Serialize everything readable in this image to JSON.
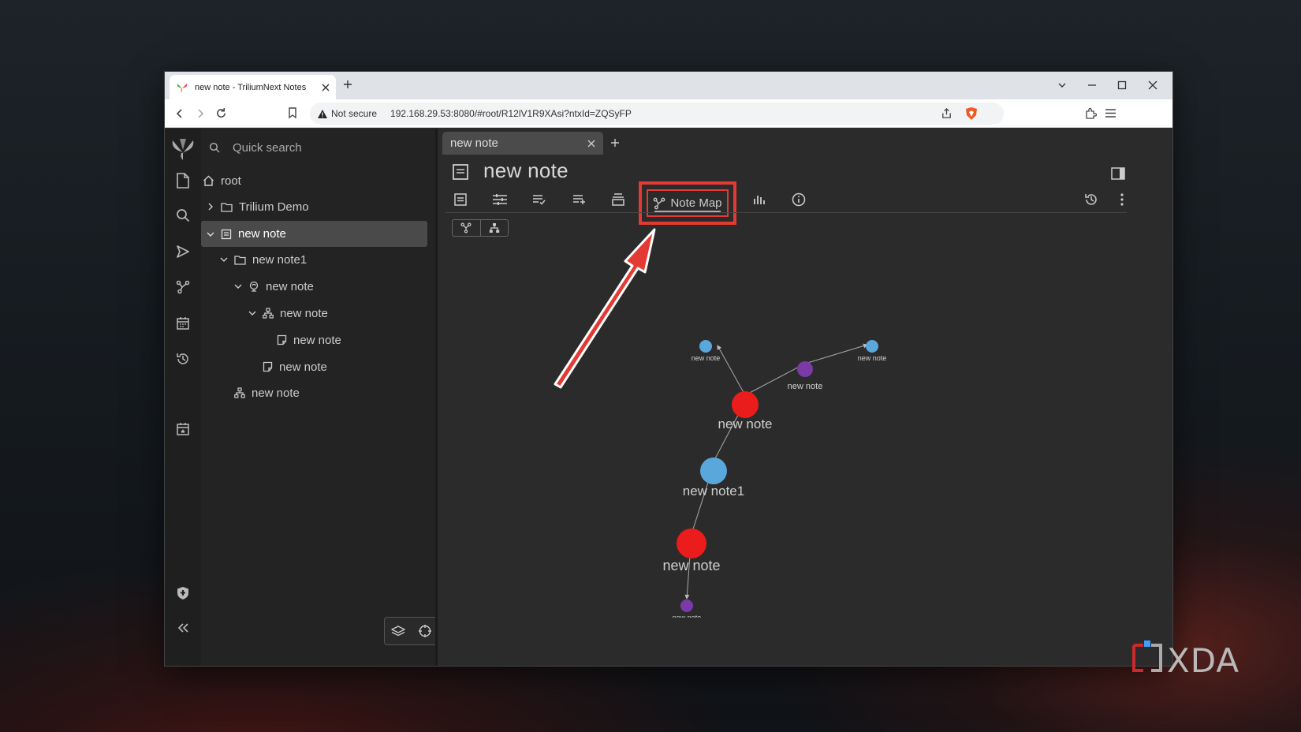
{
  "browser": {
    "tab_title": "new note - TriliumNext Notes",
    "security_label": "Not secure",
    "url": "192.168.29.53:8080/#root/R12lV1R9XAsi?ntxId=ZQSyFP"
  },
  "sidebar": {
    "quick_search_placeholder": "Quick search",
    "tree": {
      "root": "root",
      "items": [
        {
          "label": "Trilium Demo",
          "icon": "folder-icon",
          "expanded": false
        },
        {
          "label": "new note",
          "icon": "book-icon",
          "expanded": true,
          "selected": true
        },
        {
          "label": "new note1",
          "icon": "folder-icon",
          "expanded": true
        },
        {
          "label": "new note",
          "icon": "mind-map-icon",
          "expanded": true
        },
        {
          "label": "new note",
          "icon": "hierarchy-icon",
          "expanded": true
        },
        {
          "label": "new note",
          "icon": "note-icon"
        },
        {
          "label": "new note",
          "icon": "note-icon"
        },
        {
          "label": "new note",
          "icon": "hierarchy-icon"
        }
      ]
    }
  },
  "note_tab": {
    "label": "new note"
  },
  "note": {
    "title": "new note",
    "ribbon": {
      "active_tab": "Note Map"
    }
  },
  "note_map": {
    "node_colors": {
      "red": "#ea1c1c",
      "blue": "#5aa7dc",
      "purple": "#7b3aa8"
    },
    "nodes": [
      {
        "label": "new note",
        "color": "red",
        "size": "large"
      },
      {
        "label": "new note1",
        "color": "blue",
        "size": "large"
      },
      {
        "label": "new note",
        "color": "red",
        "size": "large"
      },
      {
        "label": "new note",
        "color": "purple",
        "size": "small"
      },
      {
        "label": "new note",
        "color": "blue",
        "size": "small"
      },
      {
        "label": "new note",
        "color": "purple",
        "size": "small"
      },
      {
        "label": "new note",
        "color": "blue",
        "size": "small"
      }
    ]
  },
  "watermark": {
    "text": "XDA"
  },
  "colors": {
    "highlight": "#e53a33"
  }
}
